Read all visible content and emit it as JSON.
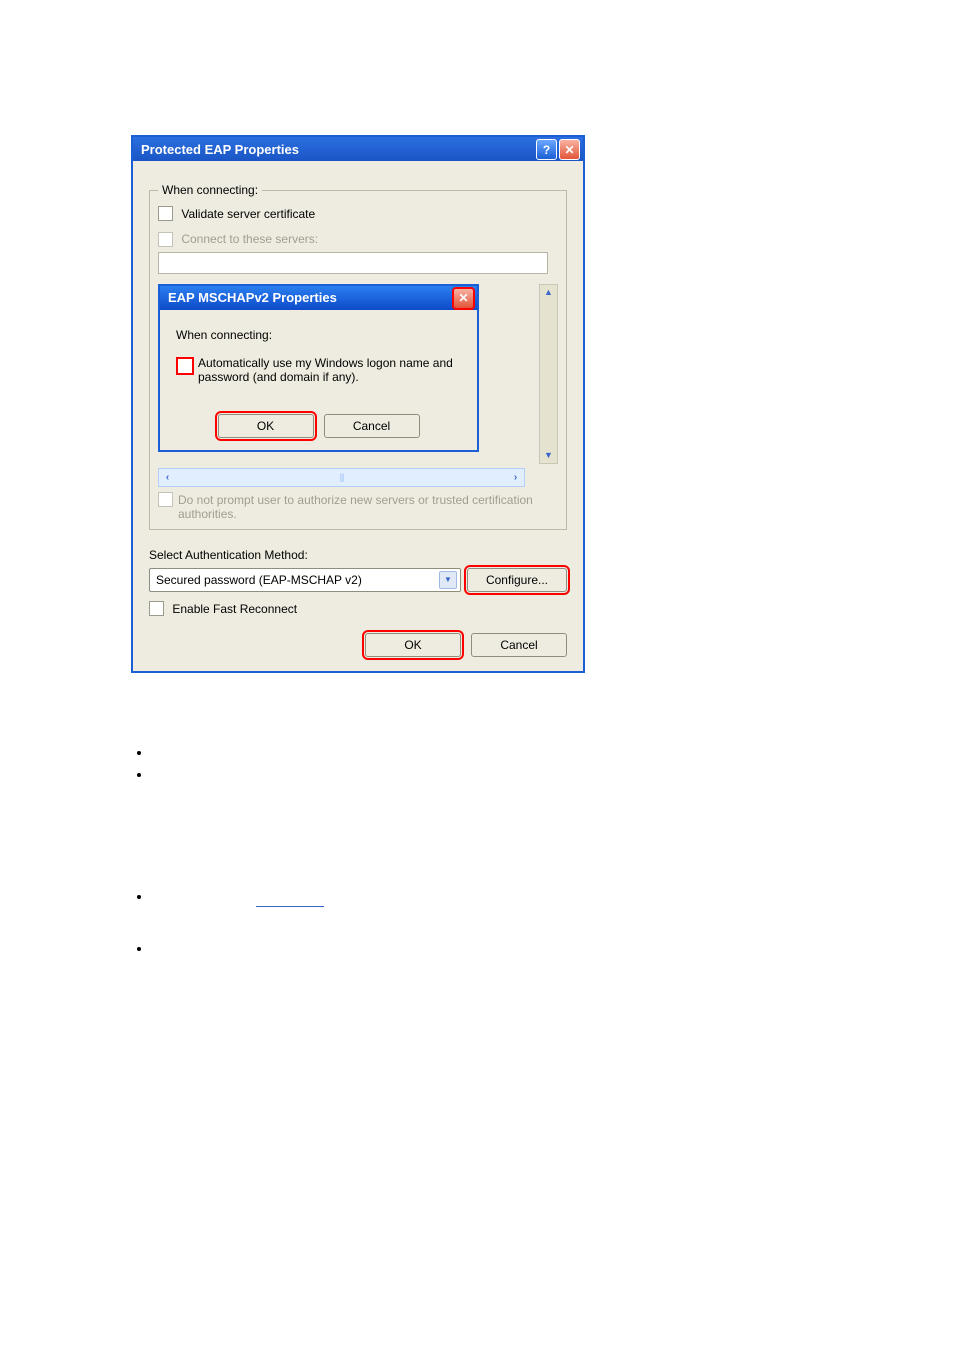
{
  "outer": {
    "title": "Protected EAP Properties",
    "when_connecting": "When connecting:",
    "validate_server": "Validate server certificate",
    "connect_servers": "Connect to these servers:",
    "noprompt": "Do not prompt user to authorize new servers or trusted certification authorities.",
    "auth_label": "Select Authentication Method:",
    "auth_value": "Secured password (EAP-MSCHAP v2)",
    "configure": "Configure...",
    "fast_reconnect": "Enable Fast Reconnect",
    "ok": "OK",
    "cancel": "Cancel"
  },
  "inner": {
    "title": "EAP MSCHAPv2 Properties",
    "when_connecting": "When connecting:",
    "auto_logon": "Automatically use my Windows logon name and password (and domain if any).",
    "ok": "OK",
    "cancel": "Cancel"
  }
}
